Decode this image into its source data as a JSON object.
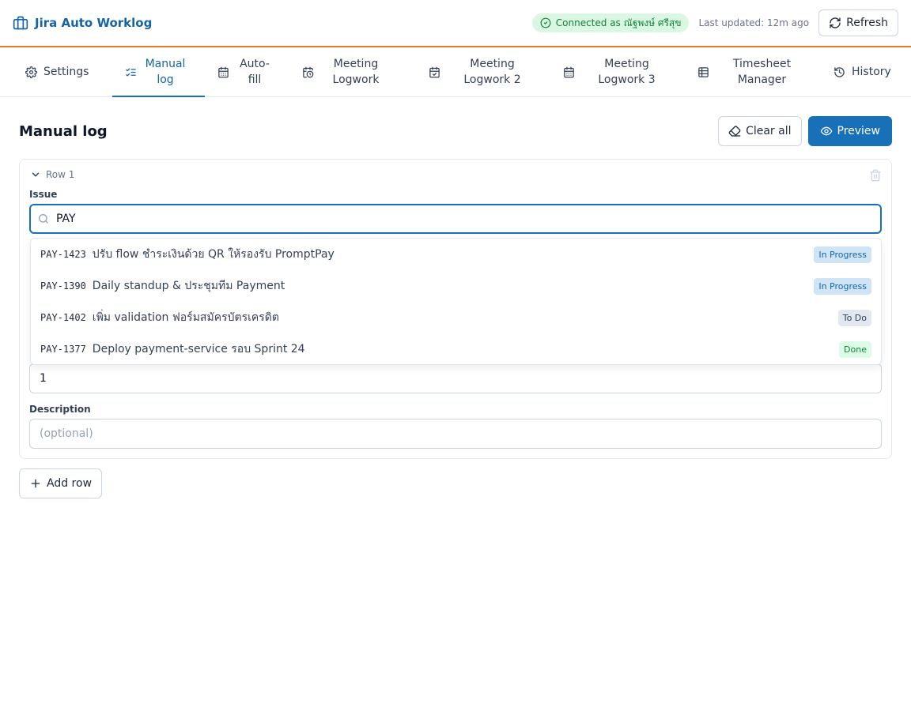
{
  "app": {
    "title": "Jira Auto Worklog"
  },
  "header": {
    "connected": "Connected as ณัฐพงษ์ ศรีสุข",
    "updated": "Last updated: 12m ago",
    "refresh": "Refresh"
  },
  "tabs": [
    {
      "label": "Settings",
      "icon": "gear-icon"
    },
    {
      "label": "Manual log",
      "icon": "list-check-icon",
      "active": true
    },
    {
      "label": "Auto-fill",
      "icon": "calendar-icon"
    },
    {
      "label": "Meeting Logwork",
      "icon": "calendar-clock-icon"
    },
    {
      "label": "Meeting Logwork 2",
      "icon": "calendar-check-icon"
    },
    {
      "label": "Meeting Logwork 3",
      "icon": "calendar-icon"
    },
    {
      "label": "Timesheet Manager",
      "icon": "table-icon"
    },
    {
      "label": "History",
      "icon": "history-icon"
    }
  ],
  "main": {
    "title": "Manual log",
    "clear_all": "Clear all",
    "preview": "Preview",
    "row": {
      "label": "Row 1",
      "issue_label": "Issue",
      "issue_value": "PAY",
      "hours_value": "1",
      "description_label": "Description",
      "description_placeholder": "(optional)"
    },
    "add_row": "Add row"
  },
  "dropdown": [
    {
      "key": "PAY-1423",
      "summary": "ปรับ flow ชำระเงินด้วย QR ให้รองรับ PromptPay",
      "status": "In Progress",
      "status_bg": "#cfe4f5",
      "status_fg": "#1565a6"
    },
    {
      "key": "PAY-1390",
      "summary": "Daily standup & ประชุมทีม Payment",
      "status": "In Progress",
      "status_bg": "#cfe4f5",
      "status_fg": "#1565a6"
    },
    {
      "key": "PAY-1402",
      "summary": "เพิ่ม validation ฟอร์มสมัครบัตรเครดิต",
      "status": "To Do",
      "status_bg": "#e2e8f0",
      "status_fg": "#334155"
    },
    {
      "key": "PAY-1377",
      "summary": "Deploy payment-service รอบ Sprint 24",
      "status": "Done",
      "status_bg": "#dcfce7",
      "status_fg": "#15803d"
    }
  ],
  "colors": {
    "accent": "#1870b8",
    "header_border": "#e8772e"
  }
}
